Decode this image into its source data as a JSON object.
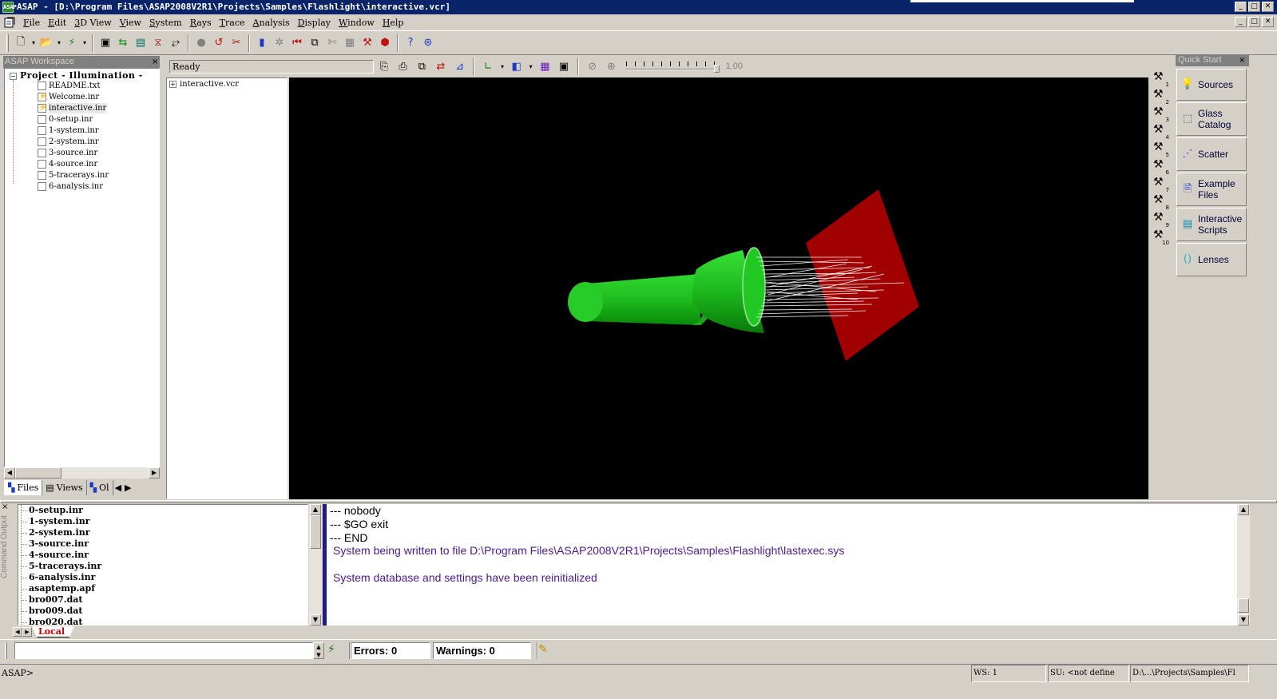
{
  "titlebar": {
    "app_icon_text": "ASAP",
    "title": "ASAP - [D:\\Program Files\\ASAP2008V2R1\\Projects\\Samples\\Flashlight\\interactive.vcr]",
    "minimize": "_",
    "maximize": "□",
    "close": "✕"
  },
  "menubar": {
    "items": [
      "File",
      "Edit",
      "3D View",
      "View",
      "System",
      "Rays",
      "Trace",
      "Analysis",
      "Display",
      "Window",
      "Help"
    ]
  },
  "workspace": {
    "header": "ASAP Workspace",
    "close": "×",
    "root": "Project - Illumination -",
    "items": [
      {
        "label": "README.txt",
        "mark": ""
      },
      {
        "label": "Welcome.inr",
        "mark": "⚡"
      },
      {
        "label": "interactive.inr",
        "mark": "⚡"
      },
      {
        "label": "0-setup.inr",
        "mark": ""
      },
      {
        "label": "1-system.inr",
        "mark": ""
      },
      {
        "label": "2-system.inr",
        "mark": ""
      },
      {
        "label": "3-source.inr",
        "mark": ""
      },
      {
        "label": "4-source.inr",
        "mark": ""
      },
      {
        "label": "5-tracerays.inr",
        "mark": ""
      },
      {
        "label": "6-analysis.inr",
        "mark": ""
      }
    ],
    "tabs": [
      "Files",
      "Views",
      "Ol"
    ]
  },
  "viewer": {
    "status": "Ready",
    "zoom_value": "1.00",
    "outline_item": "interactive.vcr"
  },
  "side_strip": {
    "icon": "hammer-icon",
    "numbers": [
      "1",
      "2",
      "3",
      "4",
      "5",
      "6",
      "7",
      "8",
      "9",
      "10"
    ]
  },
  "quick_start": {
    "header": "Quick Start",
    "close": "×",
    "buttons": [
      {
        "line1": "Sources",
        "line2": "",
        "icon": "bulb-icon"
      },
      {
        "line1": "Glass",
        "line2": "Catalog",
        "icon": "glass-icon"
      },
      {
        "line1": "Scatter",
        "line2": "",
        "icon": "scatter-icon"
      },
      {
        "line1": "Example",
        "line2": "Files",
        "icon": "document-icon"
      },
      {
        "line1": "Interactive",
        "line2": "Scripts",
        "icon": "script-icon"
      },
      {
        "line1": "Lenses",
        "line2": "",
        "icon": "lens-icon"
      }
    ]
  },
  "command_output": {
    "label": "Command Output",
    "close": "×",
    "files": [
      "0-setup.inr",
      "1-system.inr",
      "2-system.inr",
      "3-source.inr",
      "4-source.inr",
      "5-tracerays.inr",
      "6-analysis.inr",
      "asaptemp.apf",
      "bro007.dat",
      "bro009.dat",
      "bro020.dat"
    ],
    "output_lines": [
      "--- nobody",
      "--- $GO exit",
      "--- END",
      "System being written to file  D:\\Program Files\\ASAP2008V2R1\\Projects\\Samples\\Flashlight\\lastexec.sys",
      "",
      "System database and settings have been reinitialized"
    ],
    "tab_local": "Local"
  },
  "command_bar": {
    "input_value": "",
    "errors": "Errors: 0",
    "warnings": "Warnings: 0"
  },
  "statusbar": {
    "prompt": "ASAP>",
    "ws": "WS:   1",
    "su": "SU:   <not define",
    "path": "D:\\...\\Projects\\Samples\\Fl"
  },
  "colors": {
    "titlebar": "#0a246a",
    "flashlight": "#18c018",
    "target": "#a00000",
    "rays": "#ffffff",
    "viewport_bg": "#000000",
    "output_purple": "#4b1a8c",
    "divider_blue": "#1f1a8a"
  }
}
